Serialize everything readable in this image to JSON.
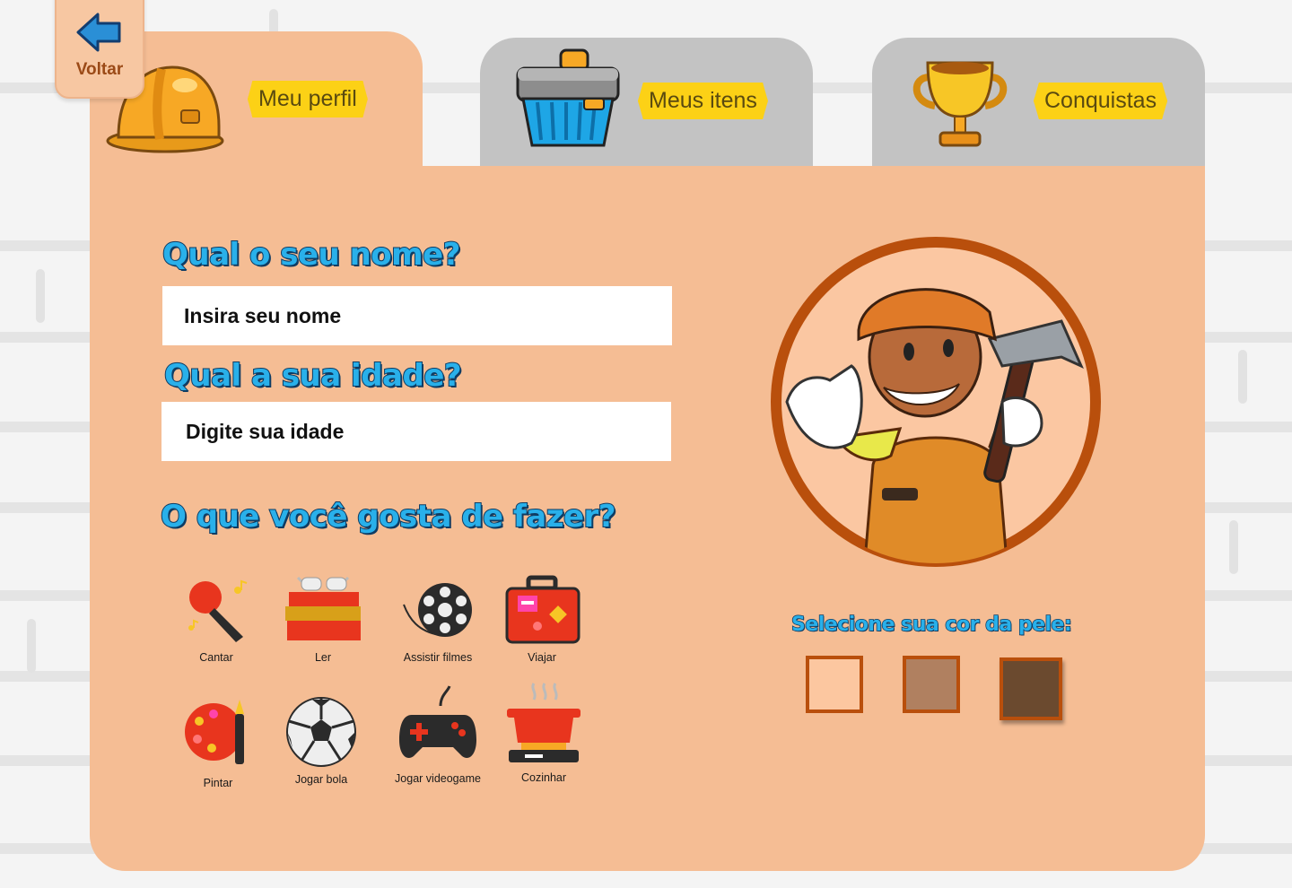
{
  "back": {
    "label": "Voltar"
  },
  "tabs": [
    {
      "label": "Meu perfil",
      "icon": "helmet-icon",
      "active": true
    },
    {
      "label": "Meus itens",
      "icon": "toolbox-icon",
      "active": false
    },
    {
      "label": "Conquistas",
      "icon": "trophy-icon",
      "active": false
    }
  ],
  "form": {
    "name_question": "Qual o seu nome?",
    "name_placeholder": "Insira seu nome",
    "age_question": "Qual a sua idade?",
    "age_placeholder": "Digite sua idade",
    "hobbies_question": "O que você gosta de fazer?"
  },
  "hobbies": [
    {
      "label": "Cantar",
      "icon": "microphone-icon"
    },
    {
      "label": "Ler",
      "icon": "books-icon"
    },
    {
      "label": "Assistir filmes",
      "icon": "film-reel-icon"
    },
    {
      "label": "Viajar",
      "icon": "suitcase-icon"
    },
    {
      "label": "Pintar",
      "icon": "palette-icon"
    },
    {
      "label": "Jogar bola",
      "icon": "soccer-ball-icon"
    },
    {
      "label": "Jogar videogame",
      "icon": "gamepad-icon"
    },
    {
      "label": "Cozinhar",
      "icon": "cooking-pot-icon"
    }
  ],
  "skin": {
    "title": "Selecione sua cor da pele:",
    "colors": [
      "#fcc7a0",
      "#b08060",
      "#6b4a2f"
    ],
    "selected_index": 2
  },
  "colors": {
    "panel": "#f5bd94",
    "inactive_tab": "#c3c3c3",
    "accent_blue": "#29b0ea",
    "label_yellow": "#fcd116"
  }
}
